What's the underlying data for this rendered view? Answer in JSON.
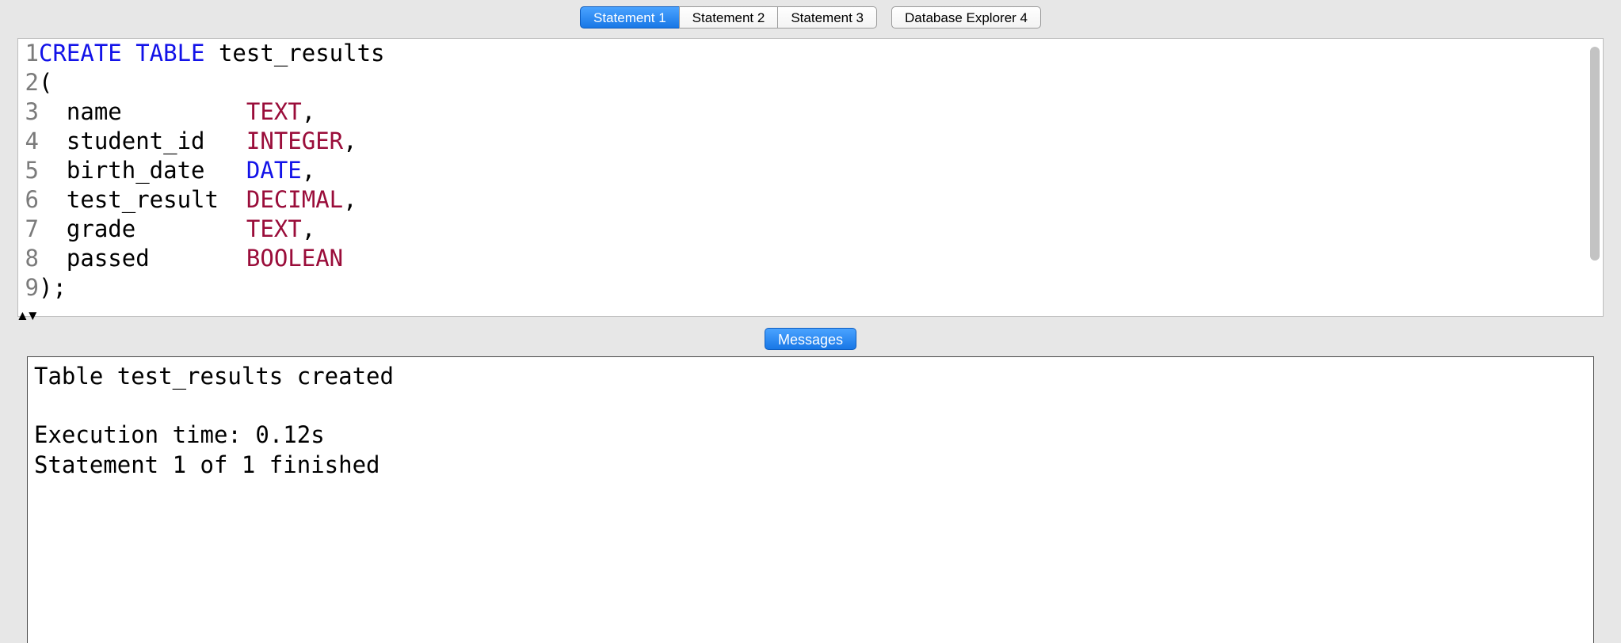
{
  "tabs": {
    "groupA": [
      {
        "label": "Statement 1",
        "active": true
      },
      {
        "label": "Statement 2",
        "active": false
      },
      {
        "label": "Statement 3",
        "active": false
      }
    ],
    "groupB": [
      {
        "label": "Database Explorer 4",
        "active": false
      }
    ]
  },
  "editor": {
    "lines": [
      {
        "n": "1",
        "segs": [
          {
            "t": "CREATE TABLE",
            "c": "kw"
          },
          {
            "t": " test_results",
            "c": ""
          }
        ]
      },
      {
        "n": "2",
        "segs": [
          {
            "t": "(",
            "c": ""
          }
        ]
      },
      {
        "n": "3",
        "segs": [
          {
            "t": "  name         ",
            "c": ""
          },
          {
            "t": "TEXT",
            "c": "ty"
          },
          {
            "t": ",",
            "c": ""
          }
        ]
      },
      {
        "n": "4",
        "segs": [
          {
            "t": "  student_id   ",
            "c": ""
          },
          {
            "t": "INTEGER",
            "c": "ty"
          },
          {
            "t": ",",
            "c": ""
          }
        ]
      },
      {
        "n": "5",
        "segs": [
          {
            "t": "  birth_date   ",
            "c": ""
          },
          {
            "t": "DATE",
            "c": "kw"
          },
          {
            "t": ",",
            "c": ""
          }
        ]
      },
      {
        "n": "6",
        "segs": [
          {
            "t": "  test_result  ",
            "c": ""
          },
          {
            "t": "DECIMAL",
            "c": "ty"
          },
          {
            "t": ",",
            "c": ""
          }
        ]
      },
      {
        "n": "7",
        "segs": [
          {
            "t": "  grade        ",
            "c": ""
          },
          {
            "t": "TEXT",
            "c": "ty"
          },
          {
            "t": ",",
            "c": ""
          }
        ]
      },
      {
        "n": "8",
        "segs": [
          {
            "t": "  passed       ",
            "c": ""
          },
          {
            "t": "BOOLEAN",
            "c": "ty"
          }
        ]
      },
      {
        "n": "9",
        "segs": [
          {
            "t": ");",
            "c": ""
          }
        ]
      }
    ]
  },
  "messages": {
    "tab_label": "Messages",
    "text": "Table test_results created\n\nExecution time: 0.12s\nStatement 1 of 1 finished"
  }
}
